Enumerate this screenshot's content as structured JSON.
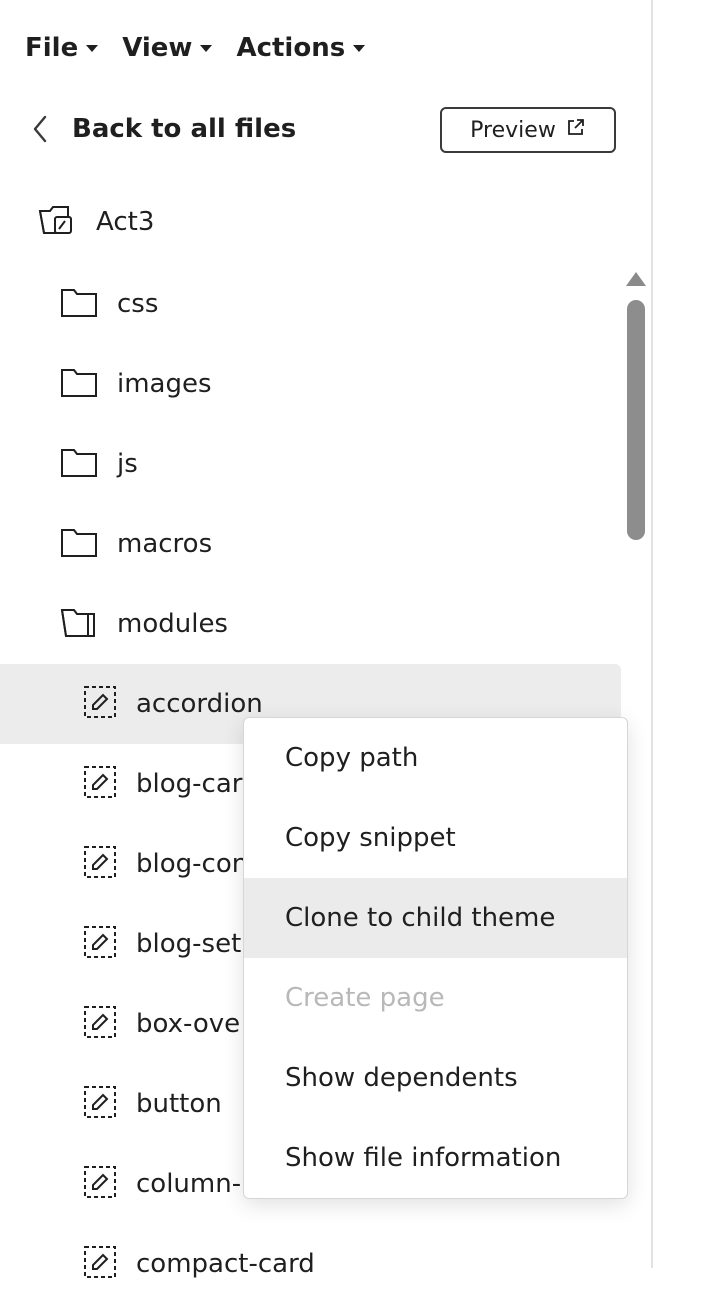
{
  "menubar": {
    "file": "File",
    "view": "View",
    "actions": "Actions"
  },
  "nav": {
    "back_label": "Back to all files",
    "preview_label": "Preview"
  },
  "root": {
    "label": "Act3"
  },
  "tree": {
    "folders": [
      "css",
      "images",
      "js",
      "macros",
      "modules"
    ],
    "modules": [
      "accordion",
      "blog-car",
      "blog-con",
      "blog-set",
      "box-ove",
      "button",
      "column-",
      "compact-card"
    ]
  },
  "selected_item": "accordion",
  "context_menu": {
    "items": [
      "Copy path",
      "Copy snippet",
      "Clone to child theme",
      "Create page",
      "Show dependents",
      "Show file information"
    ],
    "hovered": "Clone to child theme",
    "disabled": [
      "Create page"
    ]
  },
  "colors": {
    "text": "#1f1f1f",
    "selected_row": "#ececec",
    "menu_hover": "#ebebeb",
    "disabled_text": "#b8b8b8",
    "scrollbar": "#8d8d8d"
  },
  "icons": {
    "folder": "folder-icon",
    "folder_open": "folder-open-icon",
    "module": "module-icon",
    "project": "project-folder-icon",
    "back": "chevron-left-icon",
    "external": "external-link-icon",
    "caret": "caret-down-icon"
  }
}
